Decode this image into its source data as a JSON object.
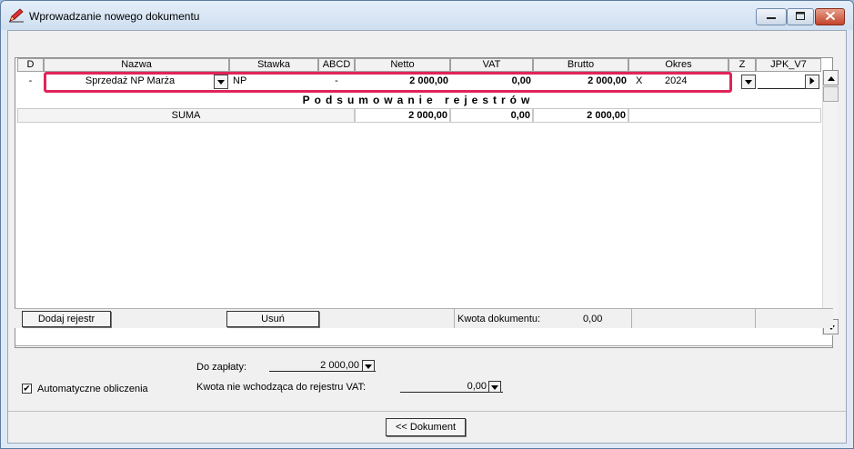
{
  "window": {
    "title": "Wprowadzanie nowego dokumentu"
  },
  "grid": {
    "columns": [
      "D",
      "Nazwa",
      "Stawka",
      "ABCD",
      "Netto",
      "VAT",
      "Brutto",
      "Okres",
      "Z",
      "JPK_V7"
    ],
    "row": {
      "d": "-",
      "nazwa": "Sprzedaż NP Marża",
      "stawka": "NP",
      "abcd": "-",
      "netto": "2 000,00",
      "vat": "0,00",
      "brutto": "2 000,00",
      "okres_x": "X",
      "okres_year": "2024",
      "z": "",
      "jpk": ""
    },
    "summary_title": "Podsumowanie rejestrów",
    "summary": {
      "label": "SUMA",
      "netto": "2 000,00",
      "vat": "0,00",
      "brutto": "2 000,00"
    }
  },
  "bottom": {
    "add_button": "Dodaj rejestr",
    "remove_button": "Usuń",
    "kwota_label": "Kwota dokumentu:",
    "kwota_value": "0,00"
  },
  "form": {
    "do_zaplaty_label": "Do zapłaty:",
    "do_zaplaty_value": "2 000,00",
    "auto_label": "Automatyczne obliczenia",
    "auto_checked": true,
    "kwota_nie_label": "Kwota nie wchodząca do rejestru VAT:",
    "kwota_nie_value": "0,00",
    "dokument_button": "<< Dokument"
  },
  "colors": {
    "highlight": "#e0245a",
    "title_bg": "#dfe9f5",
    "close_button": "#c2432a"
  },
  "icons": {
    "app": "pencil-app-icon",
    "minimize": "minimize-icon",
    "maximize": "maximize-icon",
    "close": "close-icon"
  }
}
